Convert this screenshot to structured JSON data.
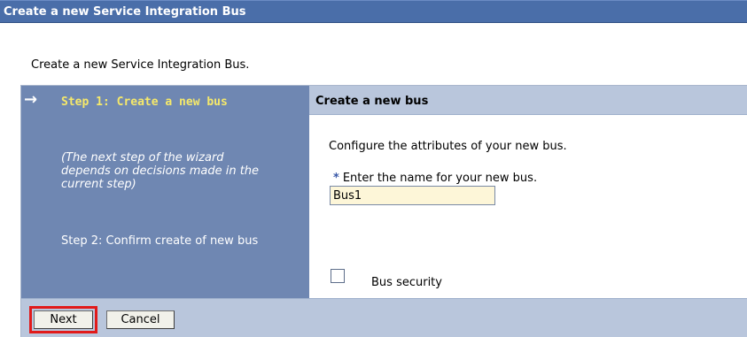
{
  "header": {
    "title": "Create a new Service Integration Bus"
  },
  "intro": "Create a new Service Integration Bus.",
  "steps": {
    "arrow": "→",
    "step1_label": "Step 1: Create a new bus",
    "note": "(The next step of the wizard depends on decisions made in the current step)",
    "step2_label": "Step 2: Confirm create of new bus"
  },
  "content": {
    "header": "Create a new bus",
    "description": "Configure the attributes of your new bus.",
    "required_marker": "*",
    "name_label": "Enter the name for your new bus.",
    "name_value": "Bus1",
    "bus_security_label": "Bus security",
    "bus_security_checked": false
  },
  "buttons": {
    "next": "Next",
    "cancel": "Cancel"
  },
  "colors": {
    "title_bar": "#4a6ea9",
    "steps_panel": "#6f87b2",
    "current_step_text": "#f6e96a",
    "content_header": "#b9c6dc",
    "input_background": "#fdf6d8",
    "highlight_border": "#e11a1a"
  }
}
